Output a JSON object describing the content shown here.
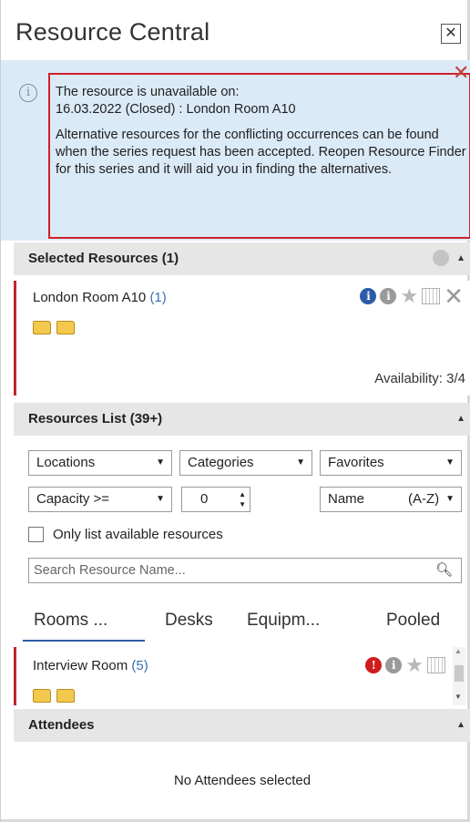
{
  "window": {
    "title": "Resource Central",
    "close_glyph": "✕"
  },
  "alert": {
    "icon": "info-icon",
    "line1": "The resource is unavailable on:",
    "line2": "16.03.2022 (Closed) :  London Room A10",
    "body": "Alternative resources for the conflicting occurrences can be found when the series request has been accepted. Reopen Resource Finder for this series and it will aid you in finding the alternatives.",
    "dismiss_glyph": "✕",
    "border_color": "#d0202a"
  },
  "selected": {
    "header": "Selected Resources (1)",
    "resource_name": "London Room A10",
    "resource_count": "(1)",
    "availability": "Availability: 3/4"
  },
  "list": {
    "header": "Resources List (39+)",
    "filters": {
      "locations": "Locations",
      "categories": "Categories",
      "favorites": "Favorites",
      "capacity": "Capacity >=",
      "capacity_value": "0",
      "sort_name": "Name",
      "sort_order": "(A-Z)"
    },
    "only_available_label": "Only list available resources",
    "only_available_checked": false,
    "search_placeholder": "Search Resource Name...",
    "tabs": [
      "Rooms ...",
      "Desks",
      "Equipm...",
      "Pooled"
    ],
    "active_tab": "Rooms ...",
    "room_name": "Interview Room",
    "room_count": "(5)"
  },
  "attendees": {
    "header": "Attendees",
    "empty_text": "No Attendees selected"
  },
  "colors": {
    "accent": "#2c5ca6",
    "alert_bg": "#dbeaf7",
    "section_bg": "#e6e6e6",
    "red_marker": "#c0272d"
  }
}
